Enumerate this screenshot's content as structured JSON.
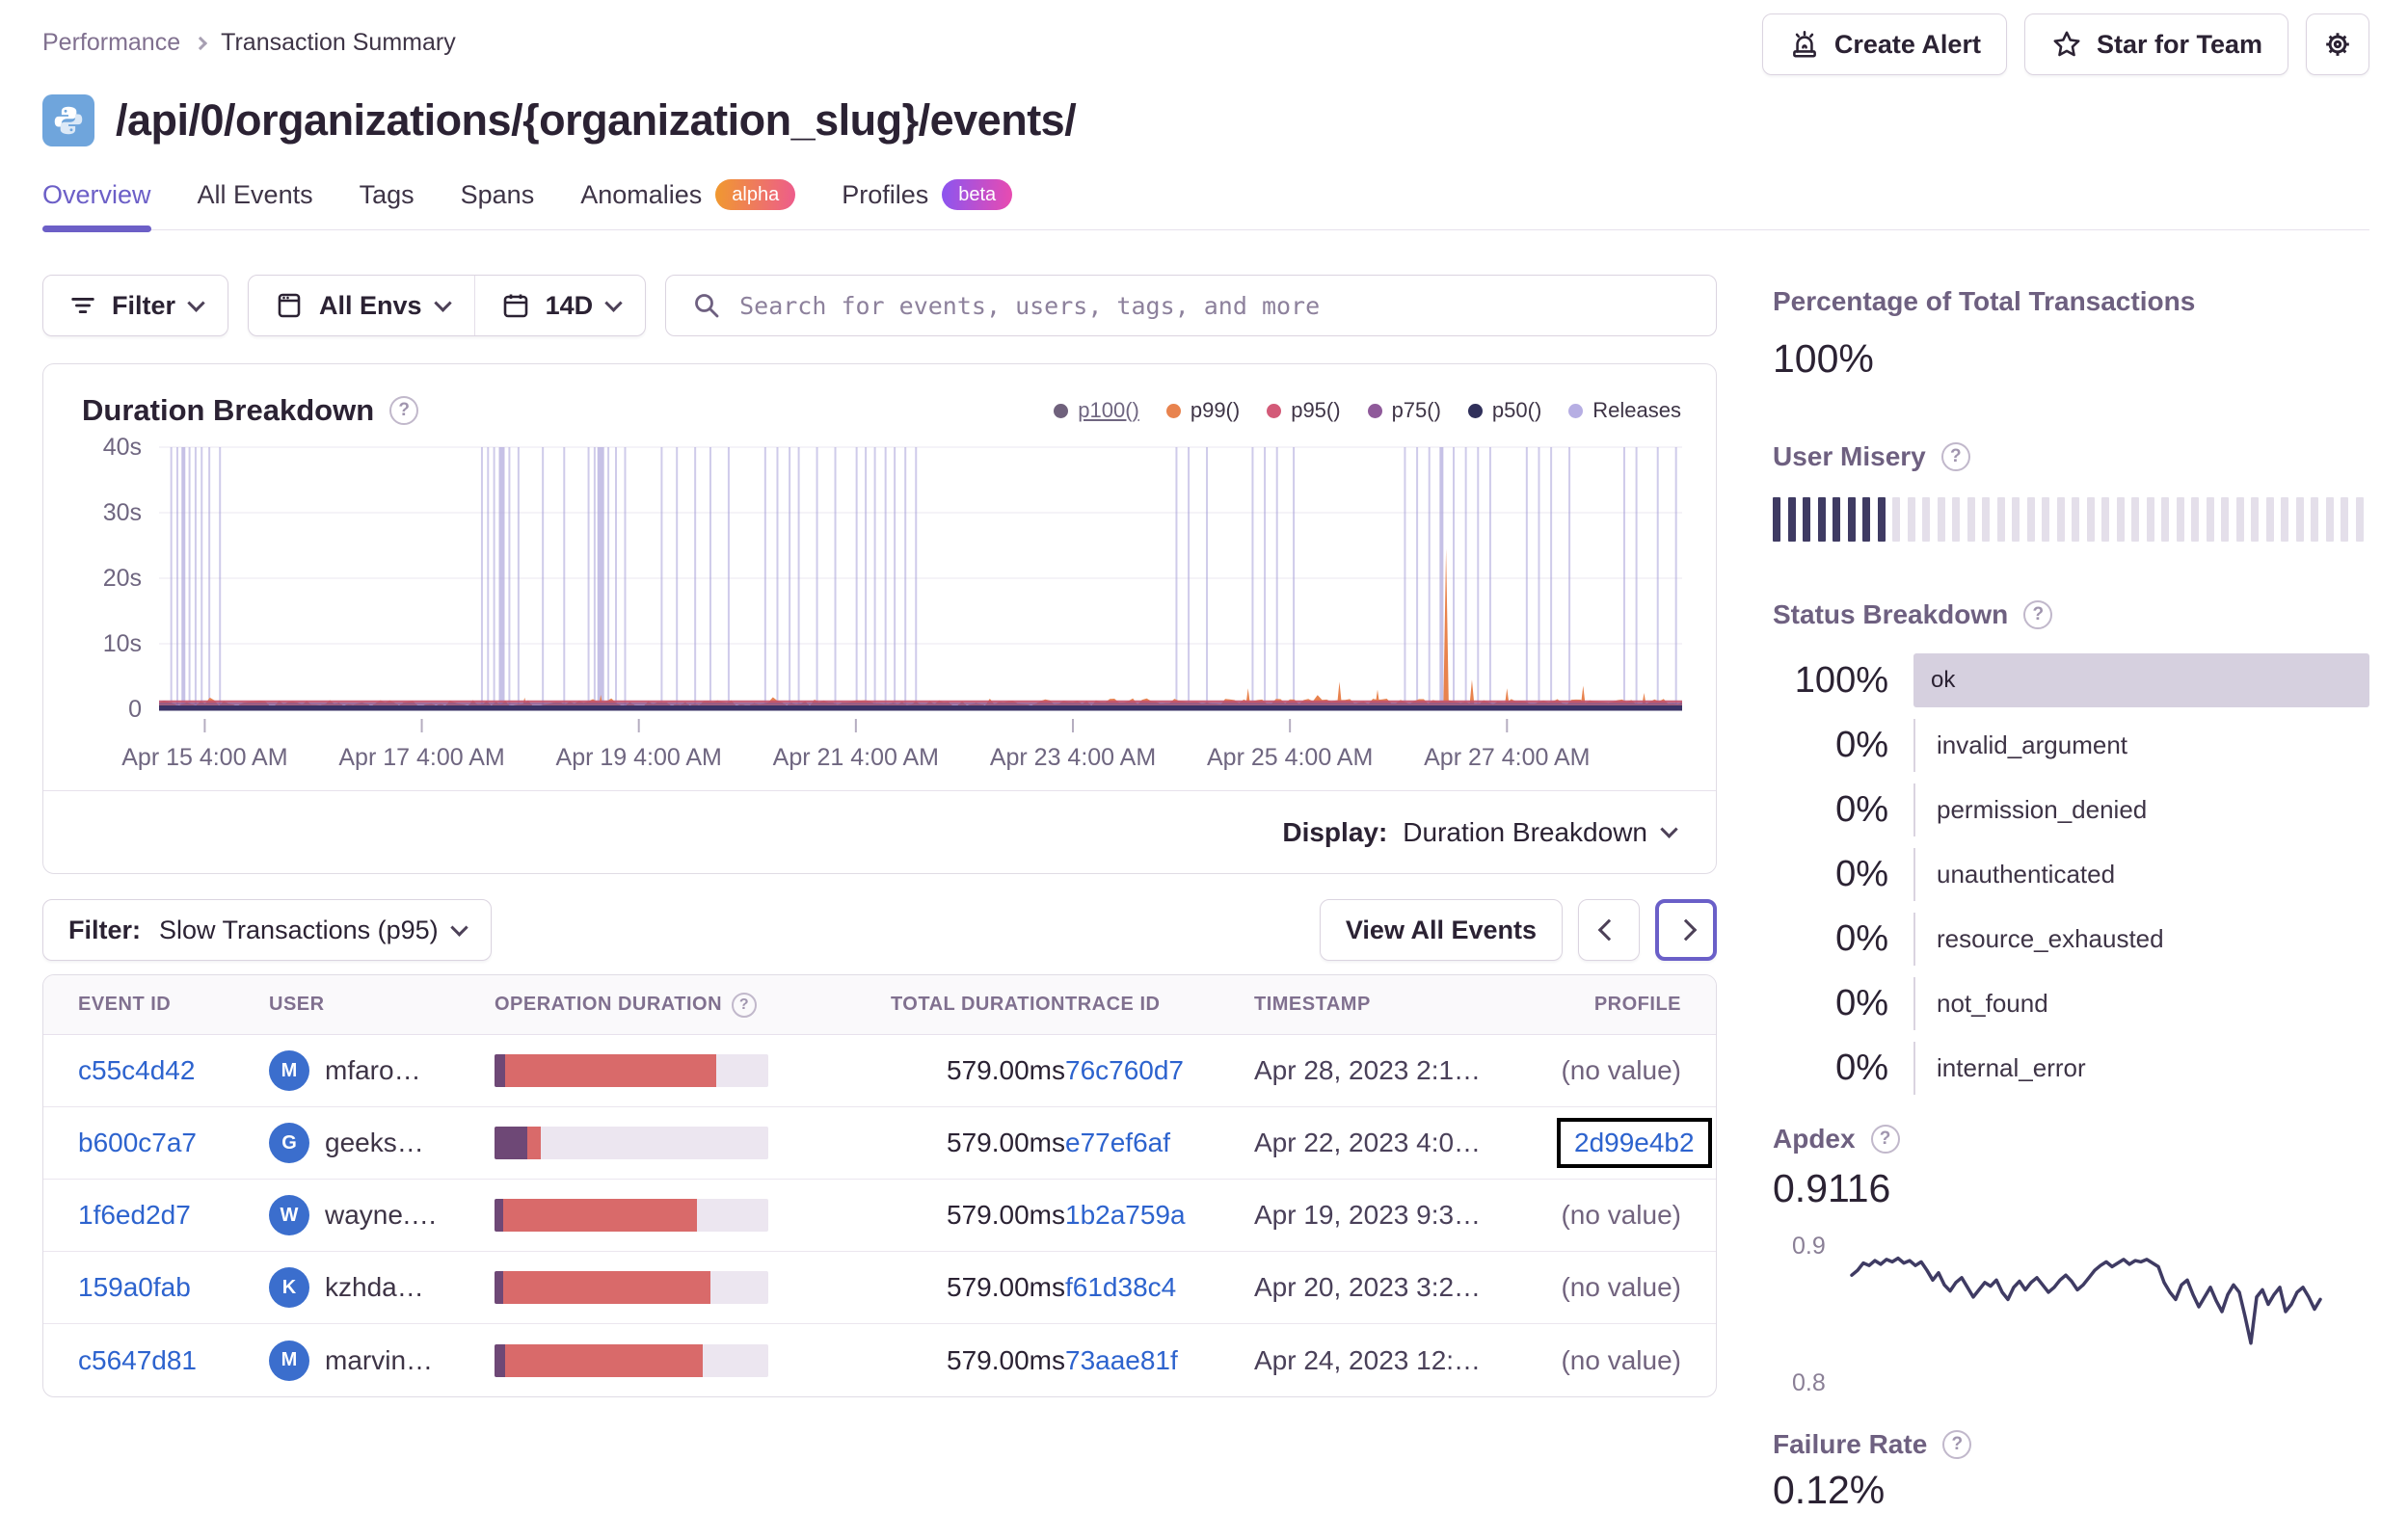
{
  "breadcrumb": {
    "parent": "Performance",
    "current": "Transaction Summary"
  },
  "header": {
    "create_alert_label": "Create Alert",
    "star_label": "Star for Team",
    "title": "/api/0/organizations/{organization_slug}/events/"
  },
  "tabs": [
    {
      "label": "Overview",
      "active": true
    },
    {
      "label": "All Events"
    },
    {
      "label": "Tags"
    },
    {
      "label": "Spans"
    },
    {
      "label": "Anomalies",
      "badge": "alpha"
    },
    {
      "label": "Profiles",
      "badge": "beta"
    }
  ],
  "filters": {
    "filter_label": "Filter",
    "envs_label": "All Envs",
    "range_label": "14D",
    "search_placeholder": "Search for events, users, tags, and more"
  },
  "duration_panel": {
    "title": "Duration Breakdown",
    "display_label": "Display:",
    "display_value": "Duration Breakdown",
    "legend": [
      {
        "label": "p100()",
        "color": "#6F617C",
        "underline": true
      },
      {
        "label": "p99()",
        "color": "#E8834E"
      },
      {
        "label": "p95()",
        "color": "#D35A78"
      },
      {
        "label": "p75()",
        "color": "#8F5A9A"
      },
      {
        "label": "p50()",
        "color": "#30305A"
      },
      {
        "label": "Releases",
        "color": "#B6AEE3"
      }
    ]
  },
  "chart_data": [
    {
      "type": "area",
      "id": "duration_breakdown",
      "title": "Duration Breakdown",
      "ylabel": "duration",
      "y_ticks": [
        "40s",
        "30s",
        "20s",
        "10s",
        "0"
      ],
      "y_max_seconds": 40,
      "x_ticks": [
        "Apr 15 4:00 AM",
        "Apr 17 4:00 AM",
        "Apr 19 4:00 AM",
        "Apr 21 4:00 AM",
        "Apr 23 4:00 AM",
        "Apr 25 4:00 AM",
        "Apr 27 4:00 AM"
      ],
      "x_tick_fractions": [
        0.03,
        0.1725,
        0.315,
        0.4575,
        0.6,
        0.7425,
        0.885
      ],
      "series_note": "p50/p75/p95 hug 0s as a flat dark band; p99 is a noisy orange band around 0.5-1.8s with spikes; p100 not visible above band except via spikes",
      "p99_base_seconds": 1.0,
      "p99_spikes": [
        {
          "x": 0.24,
          "h": 1.8
        },
        {
          "x": 0.29,
          "h": 2.2
        },
        {
          "x": 0.715,
          "h": 3.2
        },
        {
          "x": 0.775,
          "h": 4.2
        },
        {
          "x": 0.8,
          "h": 3.0
        },
        {
          "x": 0.845,
          "h": 24.5
        },
        {
          "x": 0.862,
          "h": 4.5
        },
        {
          "x": 0.885,
          "h": 3.2
        },
        {
          "x": 0.935,
          "h": 3.6
        },
        {
          "x": 0.975,
          "h": 2.5
        }
      ],
      "releases_x": [
        [
          0.008,
          2
        ],
        [
          0.012,
          2
        ],
        [
          0.016,
          4
        ],
        [
          0.02,
          2
        ],
        [
          0.024,
          2
        ],
        [
          0.028,
          2
        ],
        [
          0.033,
          2
        ],
        [
          0.04,
          2
        ],
        [
          0.212,
          2
        ],
        [
          0.216,
          2
        ],
        [
          0.22,
          2
        ],
        [
          0.225,
          6
        ],
        [
          0.23,
          2
        ],
        [
          0.236,
          2
        ],
        [
          0.252,
          2
        ],
        [
          0.266,
          2
        ],
        [
          0.282,
          2
        ],
        [
          0.286,
          2
        ],
        [
          0.29,
          7
        ],
        [
          0.295,
          2
        ],
        [
          0.3,
          2
        ],
        [
          0.306,
          2
        ],
        [
          0.33,
          2
        ],
        [
          0.34,
          2
        ],
        [
          0.352,
          2
        ],
        [
          0.362,
          2
        ],
        [
          0.374,
          2
        ],
        [
          0.398,
          2
        ],
        [
          0.406,
          2
        ],
        [
          0.414,
          2
        ],
        [
          0.42,
          2
        ],
        [
          0.432,
          2
        ],
        [
          0.444,
          2
        ],
        [
          0.458,
          2
        ],
        [
          0.464,
          2
        ],
        [
          0.47,
          2
        ],
        [
          0.477,
          2
        ],
        [
          0.483,
          2
        ],
        [
          0.49,
          2
        ],
        [
          0.497,
          2
        ],
        [
          0.668,
          2
        ],
        [
          0.676,
          2
        ],
        [
          0.688,
          2
        ],
        [
          0.718,
          2
        ],
        [
          0.726,
          2
        ],
        [
          0.734,
          2
        ],
        [
          0.745,
          2
        ],
        [
          0.818,
          2
        ],
        [
          0.826,
          2
        ],
        [
          0.834,
          2
        ],
        [
          0.842,
          4
        ],
        [
          0.85,
          2
        ],
        [
          0.858,
          2
        ],
        [
          0.866,
          2
        ],
        [
          0.874,
          2
        ],
        [
          0.898,
          2
        ],
        [
          0.906,
          2
        ],
        [
          0.914,
          2
        ],
        [
          0.926,
          2
        ],
        [
          0.962,
          2
        ],
        [
          0.97,
          2
        ],
        [
          0.984,
          2
        ],
        [
          0.996,
          2
        ]
      ],
      "colors": {
        "p99_fill": "#E8824D",
        "p95_line": "#C1536E",
        "p75_line": "#8A5590",
        "p50_band": "#3A3366",
        "release": "#A9A1D9",
        "grid": "#F2EFF5",
        "axis_text": "#6F6680"
      }
    },
    {
      "type": "line",
      "id": "apdex_trend",
      "title": "Apdex",
      "ylim": [
        0.8,
        0.905
      ],
      "y_ticks": [
        "0.9",
        "0.8"
      ],
      "color": "#3F3B63",
      "values": [
        0.876,
        0.88,
        0.886,
        0.884,
        0.888,
        0.885,
        0.889,
        0.887,
        0.89,
        0.886,
        0.888,
        0.884,
        0.887,
        0.88,
        0.872,
        0.878,
        0.868,
        0.863,
        0.87,
        0.874,
        0.866,
        0.858,
        0.864,
        0.87,
        0.867,
        0.872,
        0.862,
        0.856,
        0.866,
        0.871,
        0.864,
        0.87,
        0.874,
        0.868,
        0.862,
        0.866,
        0.872,
        0.876,
        0.871,
        0.864,
        0.868,
        0.874,
        0.88,
        0.884,
        0.887,
        0.883,
        0.886,
        0.889,
        0.885,
        0.888,
        0.887,
        0.889,
        0.886,
        0.883,
        0.87,
        0.862,
        0.856,
        0.868,
        0.872,
        0.86,
        0.85,
        0.858,
        0.866,
        0.855,
        0.846,
        0.86,
        0.868,
        0.862,
        0.842,
        0.82,
        0.858,
        0.864,
        0.852,
        0.86,
        0.866,
        0.846,
        0.852,
        0.862,
        0.866,
        0.858,
        0.848,
        0.856
      ]
    }
  ],
  "events_panel": {
    "filter_label": "Filter:",
    "filter_value": "Slow Transactions (p95)",
    "view_all_label": "View All Events",
    "columns": [
      {
        "label": "EVENT ID"
      },
      {
        "label": "USER"
      },
      {
        "label": "OPERATION DURATION",
        "help": true
      },
      {
        "label": "TOTAL DURATION",
        "align": "right"
      },
      {
        "label": "TRACE ID"
      },
      {
        "label": "TIMESTAMP"
      },
      {
        "label": "PROFILE",
        "align": "right"
      }
    ],
    "rows": [
      {
        "event_id": "c55c4d42",
        "user_initial": "M",
        "user": "mfaro…",
        "bar_purple_pct": 4,
        "bar_red_pct": 77,
        "total": "579.00ms",
        "trace_id": "76c760d7",
        "timestamp": "Apr 28, 2023 2:1…",
        "profile": "(no value)"
      },
      {
        "event_id": "b600c7a7",
        "user_initial": "G",
        "user": "geeks…",
        "bar_purple_pct": 12,
        "bar_red_pct": 5,
        "total": "579.00ms",
        "trace_id": "e77ef6af",
        "timestamp": "Apr 22, 2023 4:0…",
        "profile": "2d99e4b2",
        "profile_is_link": true,
        "profile_selected": true
      },
      {
        "event_id": "1f6ed2d7",
        "user_initial": "W",
        "user": "wayne.…",
        "bar_purple_pct": 3,
        "bar_red_pct": 71,
        "total": "579.00ms",
        "trace_id": "1b2a759a",
        "timestamp": "Apr 19, 2023 9:3…",
        "profile": "(no value)"
      },
      {
        "event_id": "159a0fab",
        "user_initial": "K",
        "user": "kzhda…",
        "bar_purple_pct": 3,
        "bar_red_pct": 76,
        "total": "579.00ms",
        "trace_id": "f61d38c4",
        "timestamp": "Apr 20, 2023 3:2…",
        "profile": "(no value)"
      },
      {
        "event_id": "c5647d81",
        "user_initial": "M",
        "user": "marvin…",
        "bar_purple_pct": 4,
        "bar_red_pct": 72,
        "total": "579.00ms",
        "trace_id": "73aae81f",
        "timestamp": "Apr 24, 2023 12:…",
        "profile": "(no value)"
      }
    ]
  },
  "sidebar": {
    "total_transactions": {
      "heading": "Percentage of Total Transactions",
      "value": "100%"
    },
    "user_misery": {
      "heading": "User Misery",
      "total_bars": 40,
      "filled_bars": 8
    },
    "status_breakdown": {
      "heading": "Status Breakdown",
      "rows": [
        {
          "pct": "100%",
          "label": "ok",
          "bar": true
        },
        {
          "pct": "0%",
          "label": "invalid_argument"
        },
        {
          "pct": "0%",
          "label": "permission_denied"
        },
        {
          "pct": "0%",
          "label": "unauthenticated"
        },
        {
          "pct": "0%",
          "label": "resource_exhausted"
        },
        {
          "pct": "0%",
          "label": "not_found"
        },
        {
          "pct": "0%",
          "label": "internal_error"
        }
      ]
    },
    "apdex": {
      "heading": "Apdex",
      "value": "0.9116",
      "tick_top": "0.9",
      "tick_bottom": "0.8"
    },
    "failure_rate": {
      "heading": "Failure Rate",
      "value": "0.12%"
    }
  },
  "colors": {
    "accent_purple": "#6C5FC7",
    "link_blue": "#2D63CE",
    "bar_purple": "#6E4876",
    "bar_red": "#D96A6A",
    "misery_filled": "#3F3B63",
    "ok_bar": "#D6D0DF"
  }
}
